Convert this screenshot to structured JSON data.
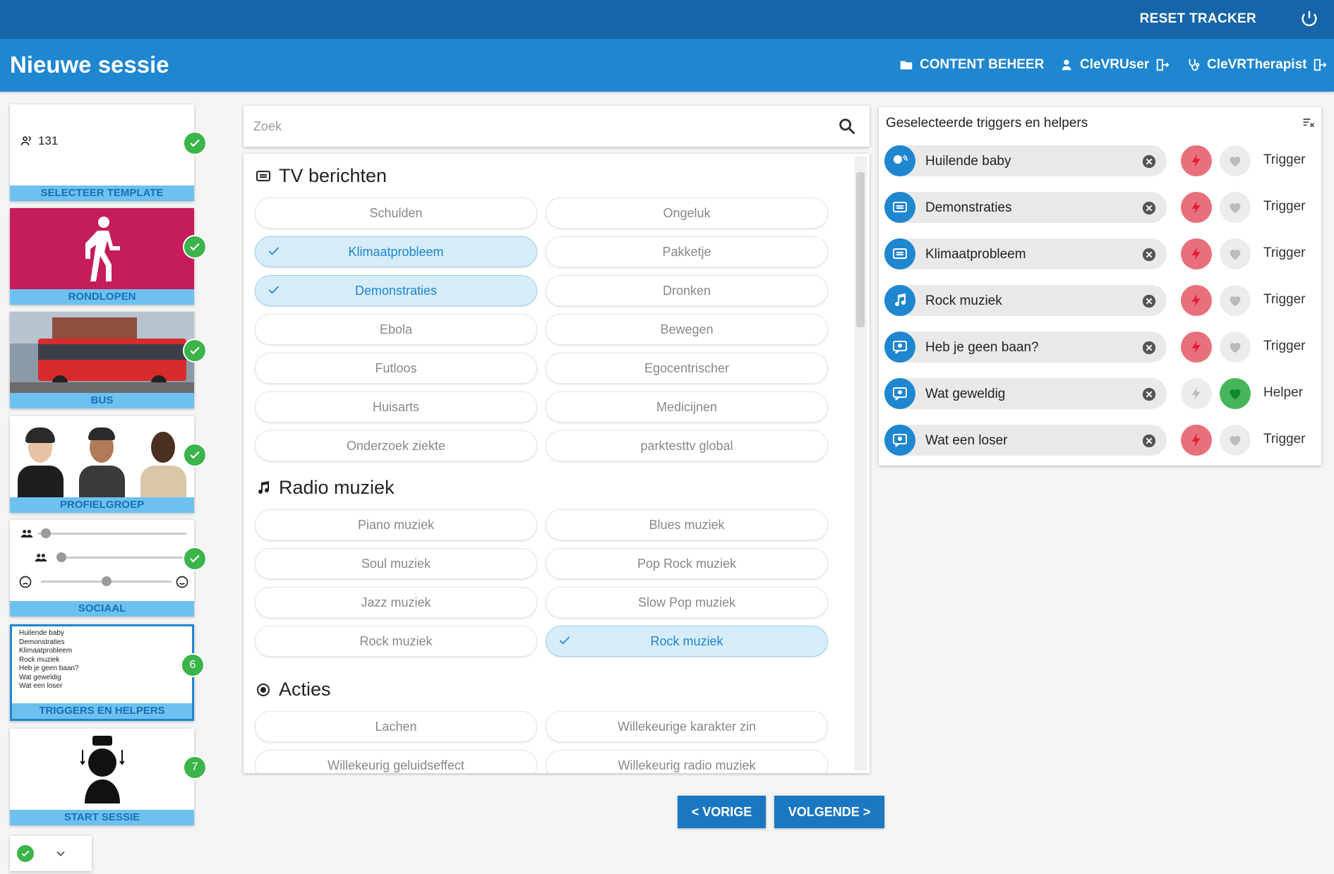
{
  "topbar": {
    "reset_label": "RESET TRACKER"
  },
  "header": {
    "title": "Nieuwe sessie",
    "content_label": "CONTENT BEHEER",
    "user_label": "CleVRUser",
    "therapist_label": "CleVRTherapist"
  },
  "steps": [
    {
      "label": "SELECTEER TEMPLATE",
      "count": "131"
    },
    {
      "label": "RONDLOPEN"
    },
    {
      "label": "BUS"
    },
    {
      "label": "PROFIELGROEP"
    },
    {
      "label": "SOCIAAL"
    },
    {
      "label": "TRIGGERS EN HELPERS",
      "number": "6",
      "mini": [
        "Huilende baby",
        "Demonstraties",
        "Klimaatprobleem",
        "Rock muziek",
        "Heb je geen baan?",
        "Wat geweldig",
        "Wat een loser"
      ]
    },
    {
      "label": "START SESSIE",
      "number": "7"
    }
  ],
  "search": {
    "placeholder": "Zoek"
  },
  "sections": {
    "tv": {
      "title": "TV berichten",
      "items": [
        "Schulden",
        "Ongeluk",
        "Klimaatprobleem",
        "Pakketje",
        "Demonstraties",
        "Dronken",
        "Ebola",
        "Bewegen",
        "Futloos",
        "Egocentrischer",
        "Huisarts",
        "Medicijnen",
        "Onderzoek ziekte",
        "parktesttv global"
      ]
    },
    "radio": {
      "title": "Radio muziek",
      "items": [
        "Piano muziek",
        "Blues muziek",
        "Soul muziek",
        "Pop Rock muziek",
        "Jazz muziek",
        "Slow Pop muziek",
        "Rock muziek",
        "Rock muziek"
      ]
    },
    "acties": {
      "title": "Acties",
      "items": [
        "Lachen",
        "Willekeurige karakter zin",
        "Willekeurig geluidseffect",
        "Willekeurig radio muziek"
      ]
    }
  },
  "selected_panel": {
    "title": "Geselecteerde triggers en helpers",
    "rows": [
      {
        "name": "Huilende baby",
        "type": "Trigger",
        "icon": "baby-icon"
      },
      {
        "name": "Demonstraties",
        "type": "Trigger",
        "icon": "tv-icon"
      },
      {
        "name": "Klimaatprobleem",
        "type": "Trigger",
        "icon": "tv-icon"
      },
      {
        "name": "Rock muziek",
        "type": "Trigger",
        "icon": "music-icon"
      },
      {
        "name": "Heb je geen baan?",
        "type": "Trigger",
        "icon": "speech-icon"
      },
      {
        "name": "Wat geweldig",
        "type": "Helper",
        "icon": "speech-icon"
      },
      {
        "name": "Wat een loser",
        "type": "Trigger",
        "icon": "speech-icon"
      }
    ]
  },
  "nav": {
    "prev_label": "< VORIGE",
    "next_label": "VOLGENDE >"
  },
  "colors": {
    "primary": "#1f86d0",
    "topbar": "#1565a8",
    "trigger": "#e84a5a",
    "helper": "#3bb44a",
    "step_label_bg": "#6ec1ee"
  }
}
